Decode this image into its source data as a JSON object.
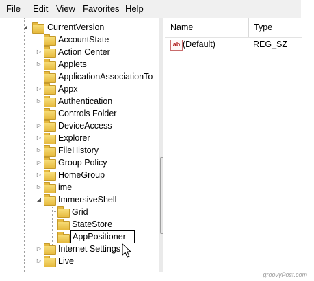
{
  "menu": [
    "File",
    "Edit",
    "View",
    "Favorites",
    "Help"
  ],
  "tree": {
    "root": "CurrentVersion",
    "children": [
      "AccountState",
      "Action Center",
      "Applets",
      "ApplicationAssociationTo",
      "Appx",
      "Authentication",
      "Controls Folder",
      "DeviceAccess",
      "Explorer",
      "FileHistory",
      "Group Policy",
      "HomeGroup",
      "ime",
      "ImmersiveShell",
      "Internet Settings",
      "Live"
    ],
    "immersive_children": [
      "Grid",
      "StateStore"
    ],
    "editing_value": "AppPositioner"
  },
  "list": {
    "headers": [
      "Name",
      "Type"
    ],
    "rows": [
      {
        "icon": "ab",
        "name": "(Default)",
        "type": "REG_SZ"
      }
    ]
  },
  "watermark": "groovyPost.com"
}
